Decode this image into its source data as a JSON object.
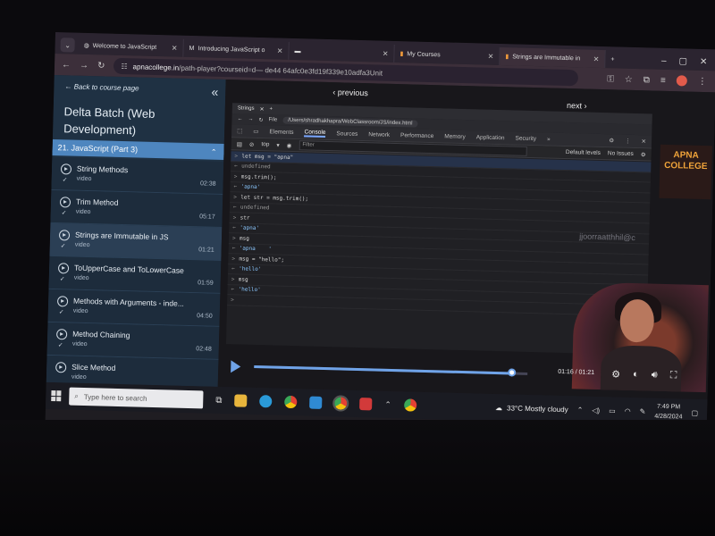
{
  "tabs": [
    {
      "label": "Welcome to JavaScript",
      "icon": "globe-icon"
    },
    {
      "label": "Introducing JavaScript o",
      "icon": "m-icon"
    },
    {
      "label": "",
      "icon": "page-icon"
    },
    {
      "label": "My Courses",
      "icon": "course-icon"
    },
    {
      "label": "Strings are Immutable in",
      "icon": "course-icon",
      "active": true
    }
  ],
  "address": {
    "host": "apnacollege.in",
    "path": "/path-player?courseid=d— de44 64afc0e3fd19f339e10adfa3Unit"
  },
  "sidebar": {
    "back": "← Back to course page",
    "course_title": "Delta Batch (Web Development)",
    "section": "21. JavaScript (Part 3)",
    "lessons": [
      {
        "title": "String Methods",
        "type": "video",
        "duration": "02:38"
      },
      {
        "title": "Trim Method",
        "type": "video",
        "duration": "05:17"
      },
      {
        "title": "Strings are Immutable in JS",
        "type": "video",
        "duration": "01:21",
        "active": true
      },
      {
        "title": "ToUpperCase and ToLowerCase",
        "type": "video",
        "duration": "01:59"
      },
      {
        "title": "Methods with Arguments - inde...",
        "type": "video",
        "duration": "04:50"
      },
      {
        "title": "Method Chaining",
        "type": "video",
        "duration": "02:48"
      },
      {
        "title": "Slice Method",
        "type": "video",
        "duration": ""
      }
    ]
  },
  "nav": {
    "previous": "‹ previous",
    "next": "next ›"
  },
  "devtools": {
    "tab_title": "Strings",
    "file_label": "File",
    "file_path": "/Users/shradhakhapra/WebClassroom/JS/index.html",
    "panels": [
      "Elements",
      "Console",
      "Sources",
      "Network",
      "Performance",
      "Memory",
      "Application",
      "Security"
    ],
    "active_panel": "Console",
    "context": "top",
    "filter_placeholder": "Filter",
    "levels": "Default levels",
    "issues": "No Issues",
    "lines": [
      {
        "p": ">",
        "t": "let msg = \"apna\"",
        "k": "in",
        "hl": true
      },
      {
        "p": "←",
        "t": "undefined",
        "k": "undef"
      },
      {
        "p": ">",
        "t": "msg.trim();",
        "k": "in"
      },
      {
        "p": "←",
        "t": "'apna'",
        "k": "out"
      },
      {
        "p": ">",
        "t": "let str = msg.trim();",
        "k": "in"
      },
      {
        "p": "←",
        "t": "undefined",
        "k": "undef"
      },
      {
        "p": ">",
        "t": "str",
        "k": "in"
      },
      {
        "p": "←",
        "t": "'apna'",
        "k": "out"
      },
      {
        "p": ">",
        "t": "msg",
        "k": "in"
      },
      {
        "p": "←",
        "t": "'apna    '",
        "k": "out"
      },
      {
        "p": ">",
        "t": "msg = \"hello\";",
        "k": "in"
      },
      {
        "p": "←",
        "t": "'hello'",
        "k": "out"
      },
      {
        "p": ">",
        "t": "msg",
        "k": "in"
      },
      {
        "p": "←",
        "t": "'hello'",
        "k": "out"
      },
      {
        "p": ">",
        "t": "",
        "k": "in"
      }
    ]
  },
  "overlay": {
    "logo": "APNA COLLEGE",
    "watermark": "jjoorraatthhil@c"
  },
  "player": {
    "time": "01:16 / 01:21",
    "progress": 0.94
  },
  "taskbar": {
    "search_placeholder": "Type here to search",
    "weather": "33°C  Mostly cloudy",
    "time": "7:49 PM",
    "date": "4/28/2024"
  }
}
